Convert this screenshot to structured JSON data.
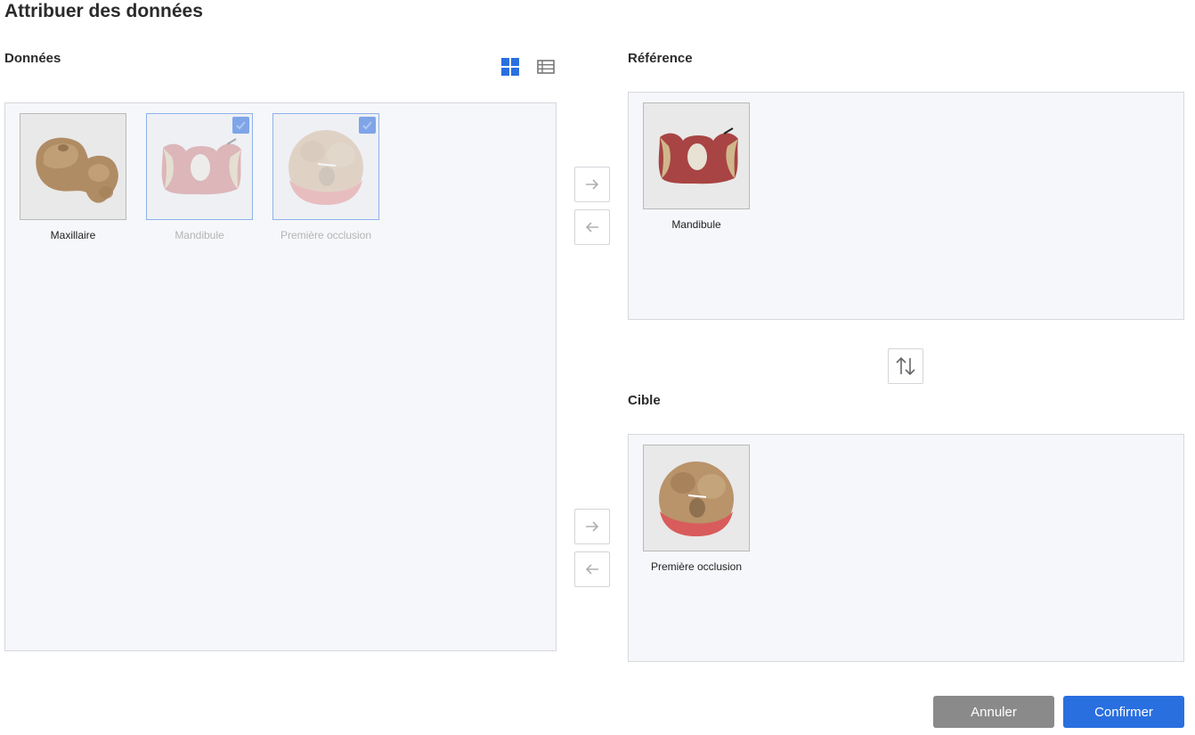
{
  "dialog": {
    "title": "Attribuer des données"
  },
  "data_section": {
    "label": "Données",
    "view_toggle": {
      "grid_icon": "grid-view-icon",
      "list_icon": "list-view-icon",
      "active": "grid"
    },
    "items": [
      {
        "label": "Maxillaire",
        "selected": false
      },
      {
        "label": "Mandibule",
        "selected": true
      },
      {
        "label": "Première occlusion",
        "selected": true
      }
    ]
  },
  "reference_section": {
    "label": "Référence",
    "items": [
      {
        "label": "Mandibule"
      }
    ]
  },
  "target_section": {
    "label": "Cible",
    "items": [
      {
        "label": "Première occlusion"
      }
    ]
  },
  "buttons": {
    "cancel": "Annuler",
    "confirm": "Confirmer"
  },
  "colors": {
    "accent": "#2a6fe0",
    "checkbox": "#7fa5e8",
    "panel_bg": "#f6f7fa",
    "cancel_bg": "#8a8a8a"
  }
}
